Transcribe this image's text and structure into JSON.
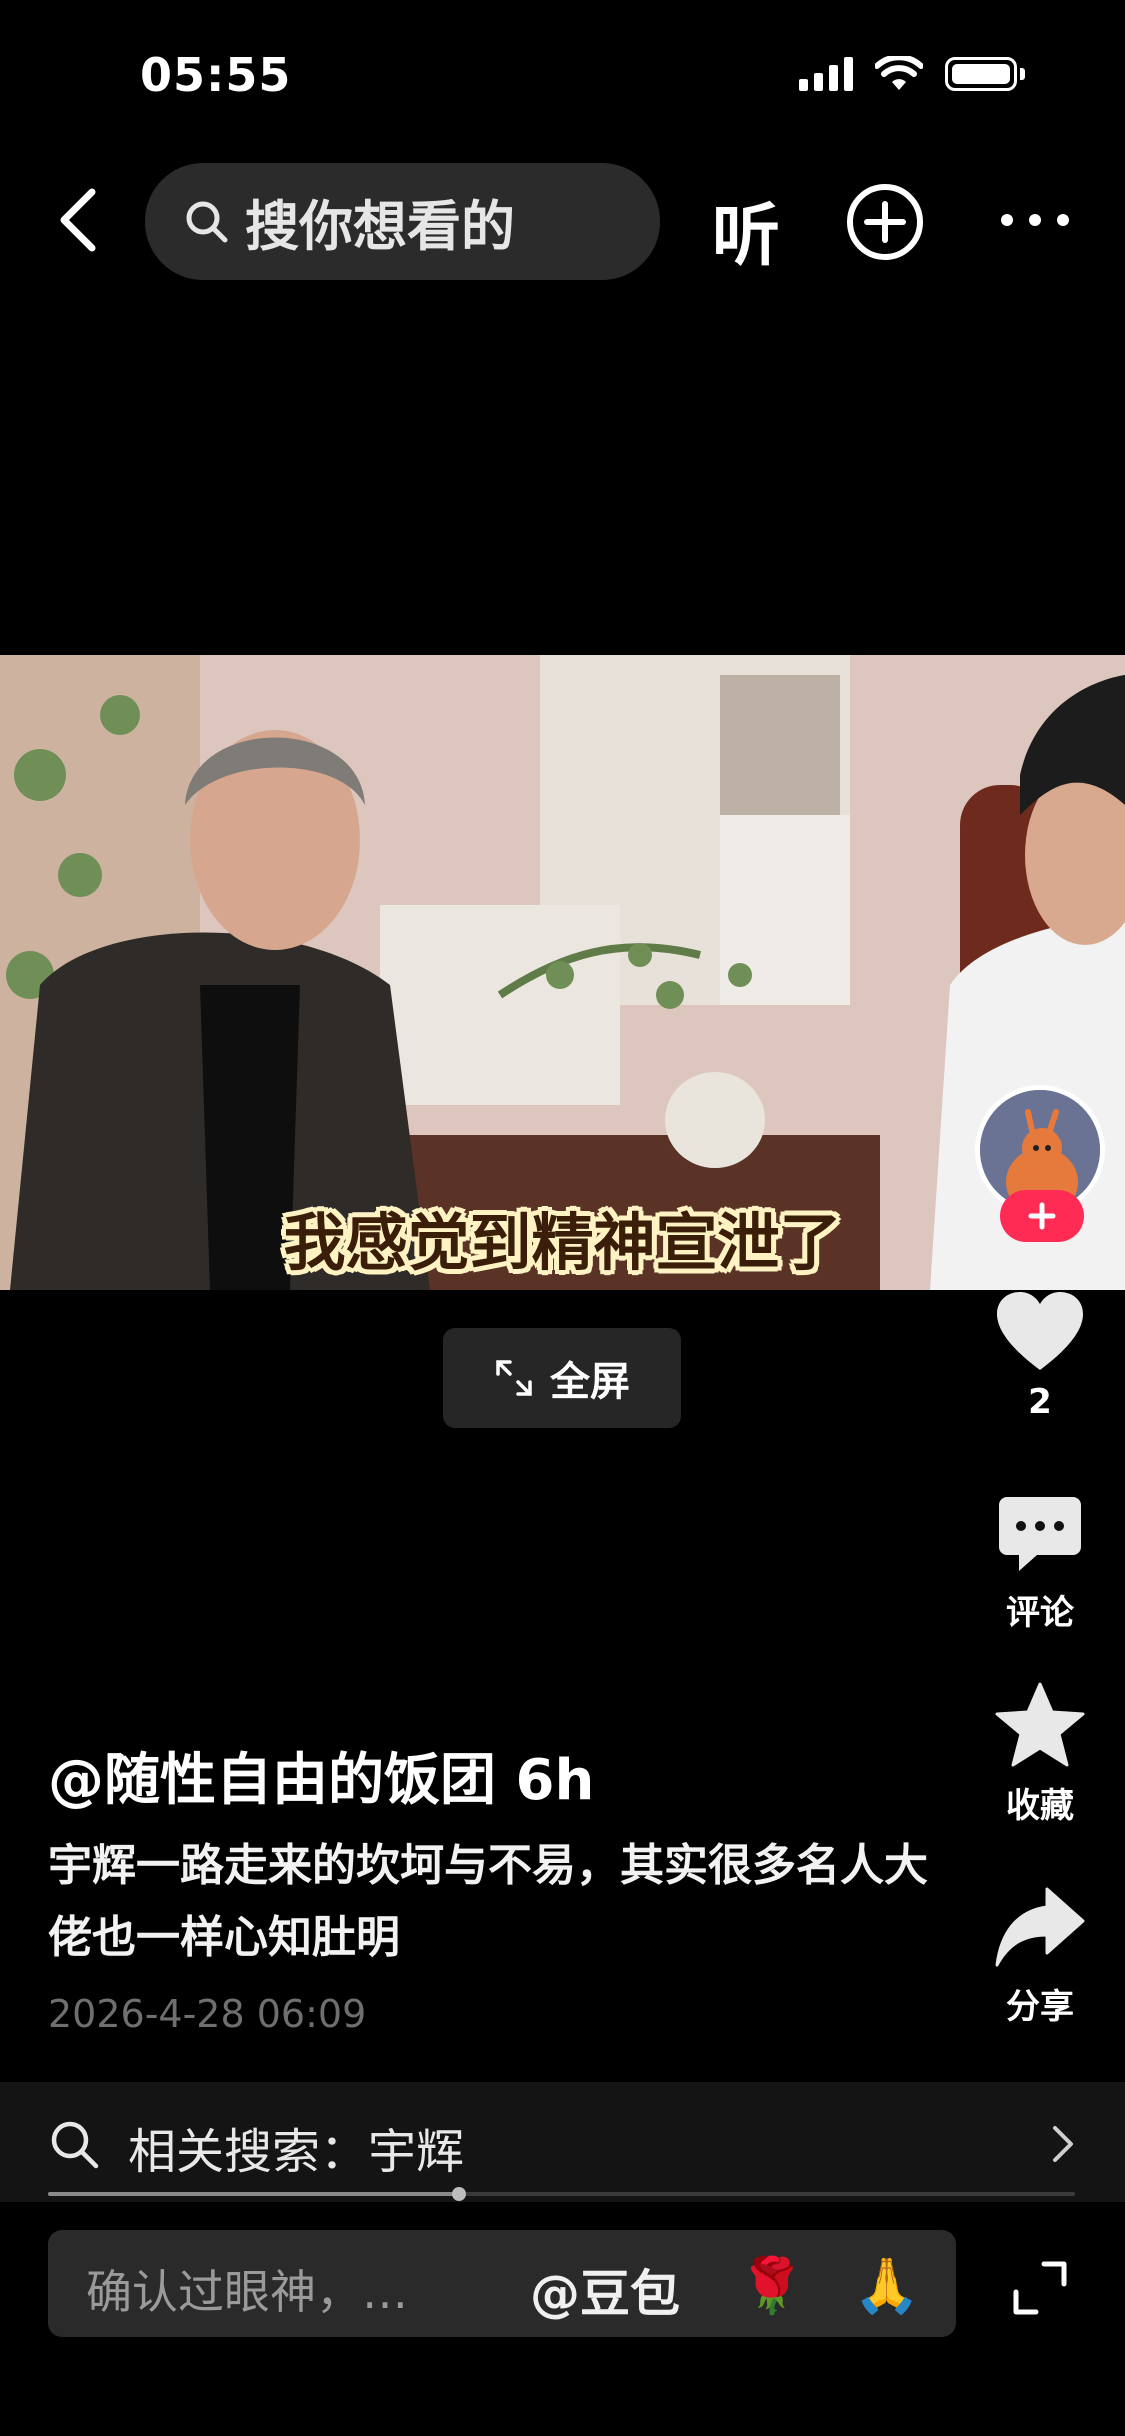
{
  "status_bar": {
    "time": "05:55"
  },
  "nav": {
    "search_placeholder": "搜你想看的",
    "listen_label": "听"
  },
  "video": {
    "subtitle": "我感觉到精神宣泄了",
    "fullscreen_label": "全屏"
  },
  "rail": {
    "like_count": "2",
    "comment_label": "评论",
    "favorite_label": "收藏",
    "share_label": "分享"
  },
  "post": {
    "author_line": "@随性自由的饭团 6h",
    "description": "宇辉一路走来的坎坷与不易，其实很多名人大佬也一样心知肚明",
    "date": "2026-4-28 06:09"
  },
  "related_search": {
    "label": "相关搜索：宇辉"
  },
  "playback": {
    "progress_fraction": 0.4
  },
  "comment_bar": {
    "placeholder": "确认过眼神，…",
    "mention": "@豆包",
    "emoji_1": "🌹",
    "emoji_2": "🙏"
  },
  "colors": {
    "accent": "#fe2c55",
    "background": "#000000"
  }
}
